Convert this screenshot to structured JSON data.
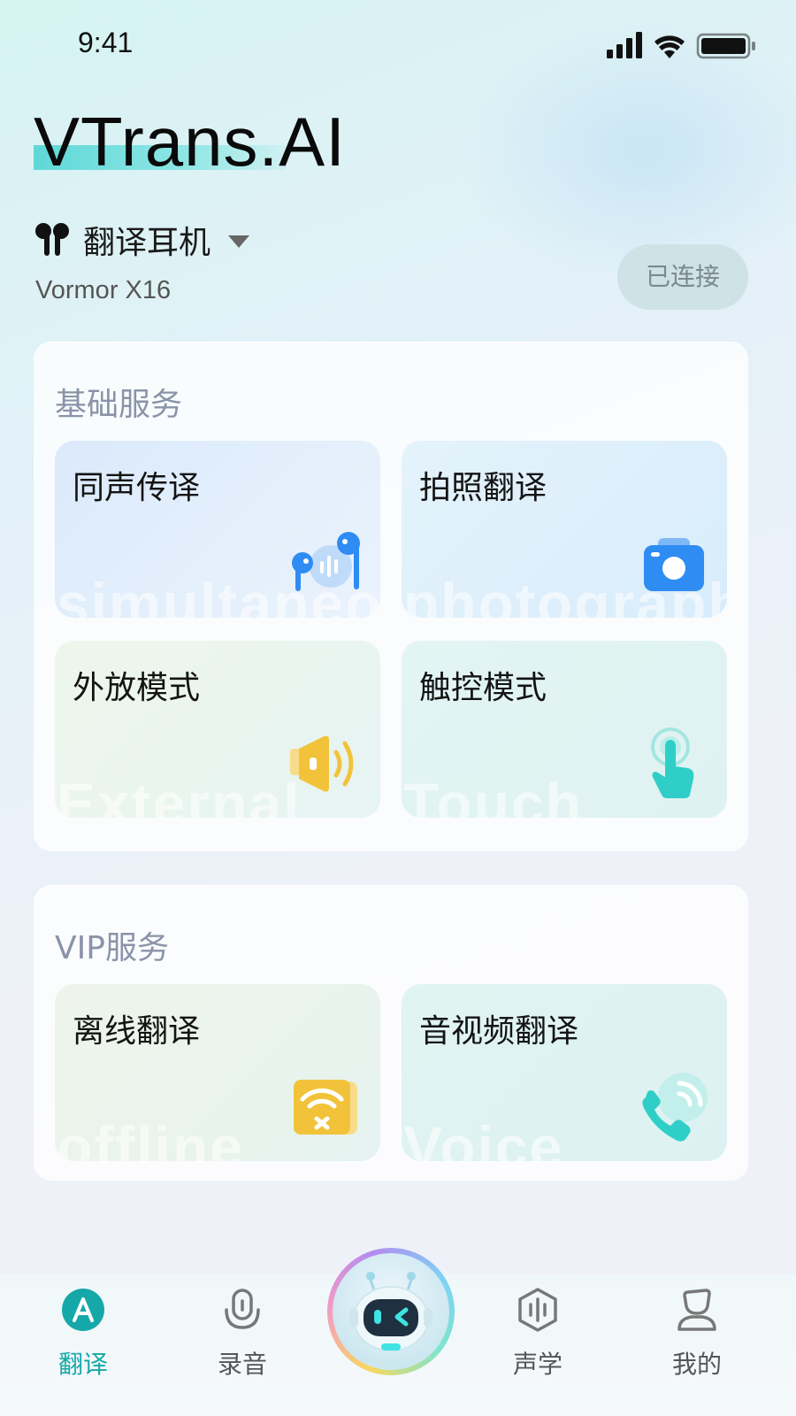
{
  "status_bar": {
    "time": "9:41"
  },
  "header": {
    "app_title": "VTrans.AI",
    "device_name": "翻译耳机",
    "device_model": "Vormor X16",
    "connection_status": "已连接"
  },
  "basic_services": {
    "title": "基础服务",
    "cards": [
      {
        "label": "同声传译",
        "watermark": "simultaneous",
        "icon": "earbuds-sound-icon"
      },
      {
        "label": "拍照翻译",
        "watermark": "photograph",
        "icon": "camera-icon"
      },
      {
        "label": "外放模式",
        "watermark": "External",
        "icon": "speaker-icon"
      },
      {
        "label": "触控模式",
        "watermark": "Touch",
        "icon": "touch-icon"
      }
    ]
  },
  "vip_services": {
    "title": "VIP服务",
    "cards": [
      {
        "label": "离线翻译",
        "watermark": "offline",
        "icon": "wifi-off-icon"
      },
      {
        "label": "音视频翻译",
        "watermark": "Voice",
        "icon": "phone-call-icon"
      }
    ]
  },
  "tab_bar": {
    "tabs": [
      {
        "label": "翻译",
        "icon": "translate-icon",
        "active": true
      },
      {
        "label": "录音",
        "icon": "microphone-icon",
        "active": false
      },
      {
        "label": "声学",
        "icon": "acoustic-icon",
        "active": false
      },
      {
        "label": "我的",
        "icon": "profile-icon",
        "active": false
      }
    ],
    "center_button_icon": "robot-assistant-icon"
  },
  "colors": {
    "accent": "#16a8a8",
    "icon_blue": "#2f8cf3",
    "icon_yellow": "#f2c33a",
    "icon_teal": "#2fcfc8"
  }
}
